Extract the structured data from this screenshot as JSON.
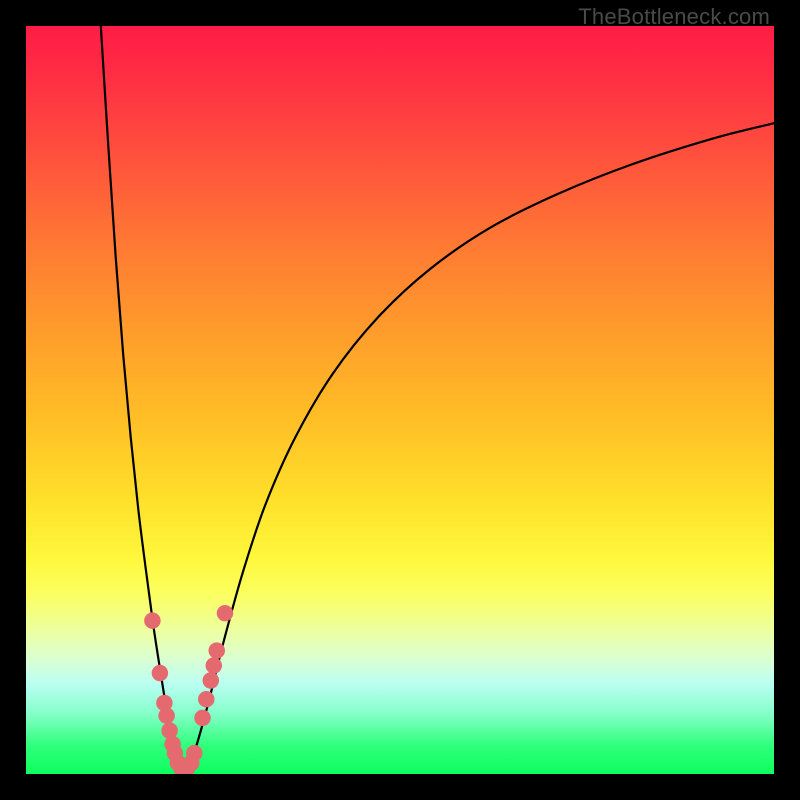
{
  "watermark": "TheBottleneck.com",
  "colors": {
    "frame_bg": "#000000",
    "curve_stroke": "#000000",
    "marker_fill": "#e46a6f",
    "gradient_top": "#ff1d46",
    "gradient_bottom": "#0cff5e"
  },
  "chart_data": {
    "type": "line",
    "title": "",
    "xlabel": "",
    "ylabel": "",
    "xlim": [
      0,
      100
    ],
    "ylim": [
      0,
      100
    ],
    "description": "Two implicit curves on a color-ramp field representing bottleneck percentage (vertical: red=high, green=zero). Left branch descends steeply from the top edge to y≈0 near x≈20; right branch rises from y≈0 near x≈22 asymptotically toward y≈90 at the far right. Salmon dots mark near-zero bottleneck samples clustered around the trough.",
    "series": [
      {
        "name": "left_branch",
        "x": [
          10.0,
          11.0,
          12.0,
          13.0,
          14.0,
          15.0,
          16.0,
          17.0,
          18.0,
          18.8,
          19.4,
          19.9,
          20.4,
          20.8
        ],
        "y": [
          100.0,
          84.0,
          69.0,
          56.0,
          45.0,
          35.5,
          27.5,
          20.0,
          13.5,
          8.5,
          5.0,
          2.5,
          1.0,
          0.2
        ]
      },
      {
        "name": "right_branch",
        "x": [
          21.3,
          22.0,
          23.0,
          24.5,
          26.5,
          29.0,
          32.0,
          36.0,
          41.0,
          47.0,
          54.0,
          62.0,
          71.0,
          81.0,
          92.0,
          100.0
        ],
        "y": [
          0.2,
          1.5,
          4.5,
          10.0,
          18.0,
          27.0,
          36.0,
          45.0,
          53.5,
          61.0,
          67.5,
          73.0,
          77.5,
          81.5,
          85.0,
          87.0
        ]
      }
    ],
    "markers": {
      "name": "near_zero_samples",
      "points": [
        {
          "x": 16.9,
          "y": 20.5
        },
        {
          "x": 17.9,
          "y": 13.5
        },
        {
          "x": 18.5,
          "y": 9.5
        },
        {
          "x": 18.8,
          "y": 7.8
        },
        {
          "x": 19.2,
          "y": 5.8
        },
        {
          "x": 19.6,
          "y": 4.0
        },
        {
          "x": 19.9,
          "y": 2.8
        },
        {
          "x": 20.3,
          "y": 1.5
        },
        {
          "x": 20.8,
          "y": 0.7
        },
        {
          "x": 21.5,
          "y": 0.7
        },
        {
          "x": 22.1,
          "y": 1.5
        },
        {
          "x": 22.5,
          "y": 2.8
        },
        {
          "x": 23.6,
          "y": 7.5
        },
        {
          "x": 24.1,
          "y": 10.0
        },
        {
          "x": 24.7,
          "y": 12.5
        },
        {
          "x": 25.1,
          "y": 14.5
        },
        {
          "x": 25.5,
          "y": 16.5
        },
        {
          "x": 26.6,
          "y": 21.5
        }
      ],
      "radius_pct": 1.1
    }
  }
}
